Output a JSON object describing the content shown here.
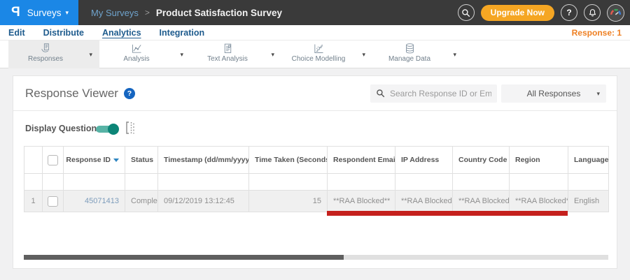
{
  "topbar": {
    "logo_letter": "P",
    "product_menu_label": "Surveys",
    "breadcrumb": {
      "parent": "My Surveys",
      "separator": ">",
      "current": "Product Satisfaction Survey"
    },
    "upgrade_label": "Upgrade Now",
    "help_glyph": "?"
  },
  "nav": {
    "items": [
      {
        "label": "Edit",
        "active": false
      },
      {
        "label": "Distribute",
        "active": false
      },
      {
        "label": "Analytics",
        "active": true
      },
      {
        "label": "Integration",
        "active": false
      }
    ],
    "response_count": "Response: 1"
  },
  "toolbar": {
    "items": [
      {
        "label": "Responses",
        "icon": "responses-icon",
        "selected": true
      },
      {
        "label": "Analysis",
        "icon": "analysis-icon",
        "selected": false
      },
      {
        "label": "Text Analysis",
        "icon": "text-analysis-icon",
        "selected": false
      },
      {
        "label": "Choice Modelling",
        "icon": "choice-modelling-icon",
        "selected": false
      },
      {
        "label": "Manage Data",
        "icon": "manage-data-icon",
        "selected": false
      }
    ]
  },
  "viewer": {
    "title": "Response Viewer",
    "help_glyph": "?",
    "search_placeholder": "Search Response ID or Email",
    "filter_selected": "All Responses",
    "display_questions_label": "Display Questions",
    "display_questions_on": true
  },
  "table": {
    "columns": [
      {
        "key": "rownum",
        "label": ""
      },
      {
        "key": "checkbox",
        "label": ""
      },
      {
        "key": "response_id",
        "label": "Response ID",
        "sort": "desc"
      },
      {
        "key": "status",
        "label": "Status"
      },
      {
        "key": "timestamp",
        "label": "Timestamp (dd/mm/yyyy)",
        "sort": "both"
      },
      {
        "key": "time_taken",
        "label": "Time Taken (Seconds)",
        "sort": "both"
      },
      {
        "key": "respondent_email",
        "label": "Respondent Email"
      },
      {
        "key": "ip_address",
        "label": "IP Address"
      },
      {
        "key": "country_code",
        "label": "Country Code"
      },
      {
        "key": "region",
        "label": "Region"
      },
      {
        "key": "language",
        "label": "Language"
      }
    ],
    "rows": [
      {
        "num": "1",
        "response_id": "45071413",
        "status": "Completed",
        "timestamp": "09/12/2019 13:12:45",
        "time_taken": "15",
        "respondent_email": "**RAA Blocked**",
        "ip_address": "**RAA Blocked**",
        "country_code": "**RAA Blocked**",
        "region": "**RAA Blocked**",
        "language": "English"
      }
    ]
  },
  "icons": {
    "search-icon": "magnifier",
    "bell-icon": "notification bell",
    "help-icon": "question mark circle",
    "avatar-icon": "colored gauge profile",
    "column-navigator-icon": "bracket with dotted column",
    "sort-icons": "up/down triangles"
  },
  "colors": {
    "brand_blue": "#1b87e6",
    "topbar_gray": "#3a3a3a",
    "upgrade_orange": "#f5a623",
    "response_count_orange": "#ee7f22",
    "nav_link_blue": "#1e5b8d",
    "toggle_teal": "#0c8577",
    "annotation_red": "#c5201d",
    "breadcrumb_parent_blue": "#6fa3cc"
  }
}
